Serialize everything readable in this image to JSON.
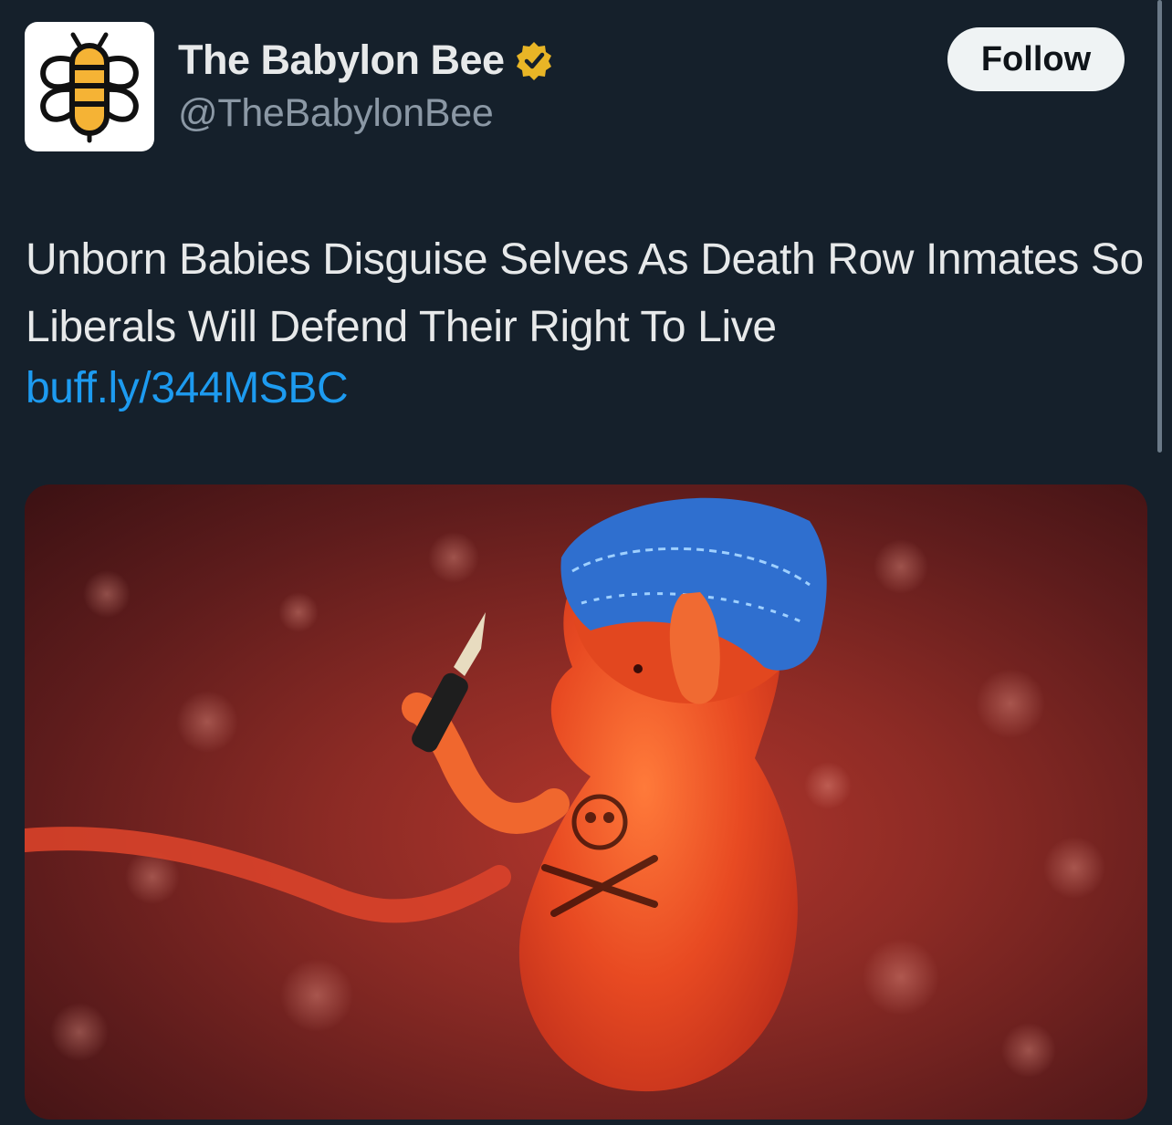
{
  "author": {
    "display_name": "The Babylon Bee",
    "handle": "@TheBabylonBee",
    "avatar_icon": "babylon-bee-logo-icon",
    "verified_icon": "verified-gold-badge-icon",
    "verified_color": "#e8b526"
  },
  "follow_button": {
    "label": "Follow"
  },
  "tweet": {
    "text": "Unborn Babies Disguise Selves As Death Row Inmates So Liberals Will Defend Their Right To Live",
    "link": "buff.ly/344MSBC"
  },
  "media": {
    "kind": "image",
    "icon": "embryo-with-bandana-and-knife-illustration"
  },
  "colors": {
    "background": "#15202b",
    "text": "#e7e9ea",
    "secondary_text": "#8b98a5",
    "link": "#1d9bf0",
    "follow_bg": "#eff3f4",
    "bee_yellow": "#f5b335"
  }
}
